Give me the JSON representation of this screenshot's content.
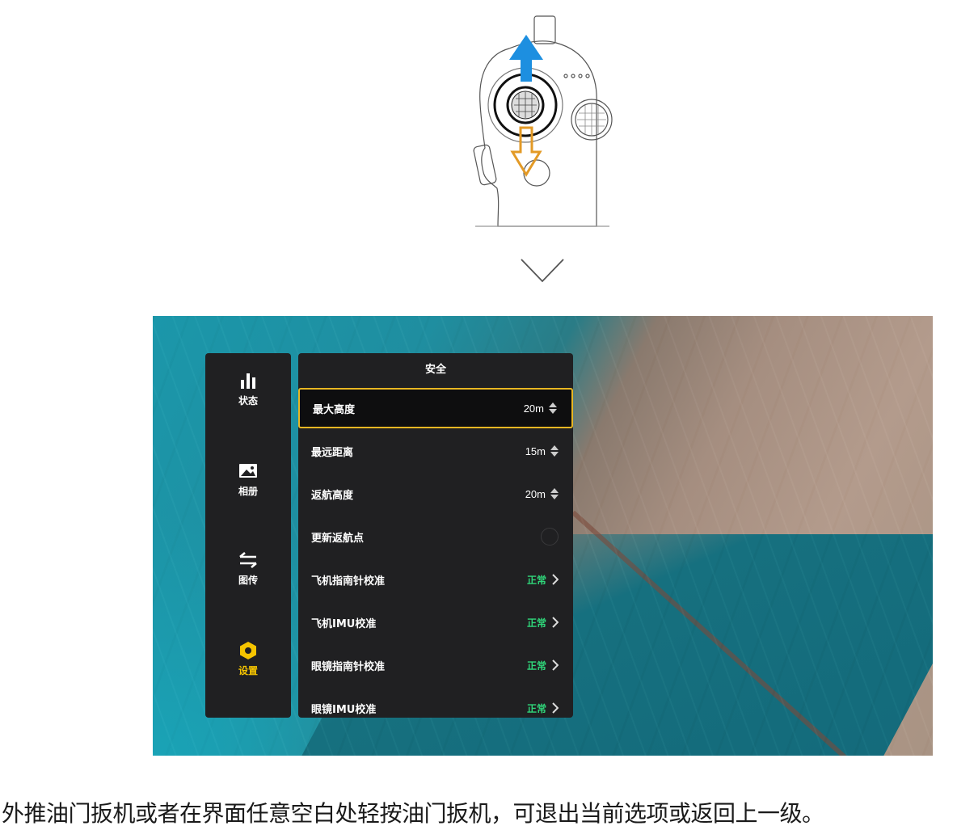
{
  "sidebar": {
    "items": [
      {
        "label": "状态",
        "icon": "bar-chart-icon",
        "active": false
      },
      {
        "label": "相册",
        "icon": "image-icon",
        "active": false
      },
      {
        "label": "图传",
        "icon": "transfer-arrows-icon",
        "active": false
      },
      {
        "label": "设置",
        "icon": "settings-hex-icon",
        "active": true
      }
    ]
  },
  "panel": {
    "title": "安全",
    "rows": [
      {
        "label": "最大高度",
        "value": "20m",
        "kind": "stepper",
        "selected": true
      },
      {
        "label": "最远距离",
        "value": "15m",
        "kind": "stepper"
      },
      {
        "label": "返航高度",
        "value": "20m",
        "kind": "stepper"
      },
      {
        "label": "更新返航点",
        "kind": "radio"
      },
      {
        "label": "飞机指南针校准",
        "status": "正常",
        "kind": "link"
      },
      {
        "label": "飞机IMU校准",
        "status": "正常",
        "kind": "link"
      },
      {
        "label": "眼镜指南针校准",
        "status": "正常",
        "kind": "link"
      },
      {
        "label": "眼镜IMU校准",
        "status": "正常",
        "kind": "link"
      }
    ]
  },
  "caption": "外推油门扳机或者在界面任意空白处轻按油门扳机，可退出当前选项或返回上一级。",
  "colors": {
    "accent": "#f5c400",
    "status_ok": "#2fd67a",
    "panel_bg": "#202022",
    "arrow_up": "#1d8fe0",
    "arrow_down": "#e39a26"
  }
}
